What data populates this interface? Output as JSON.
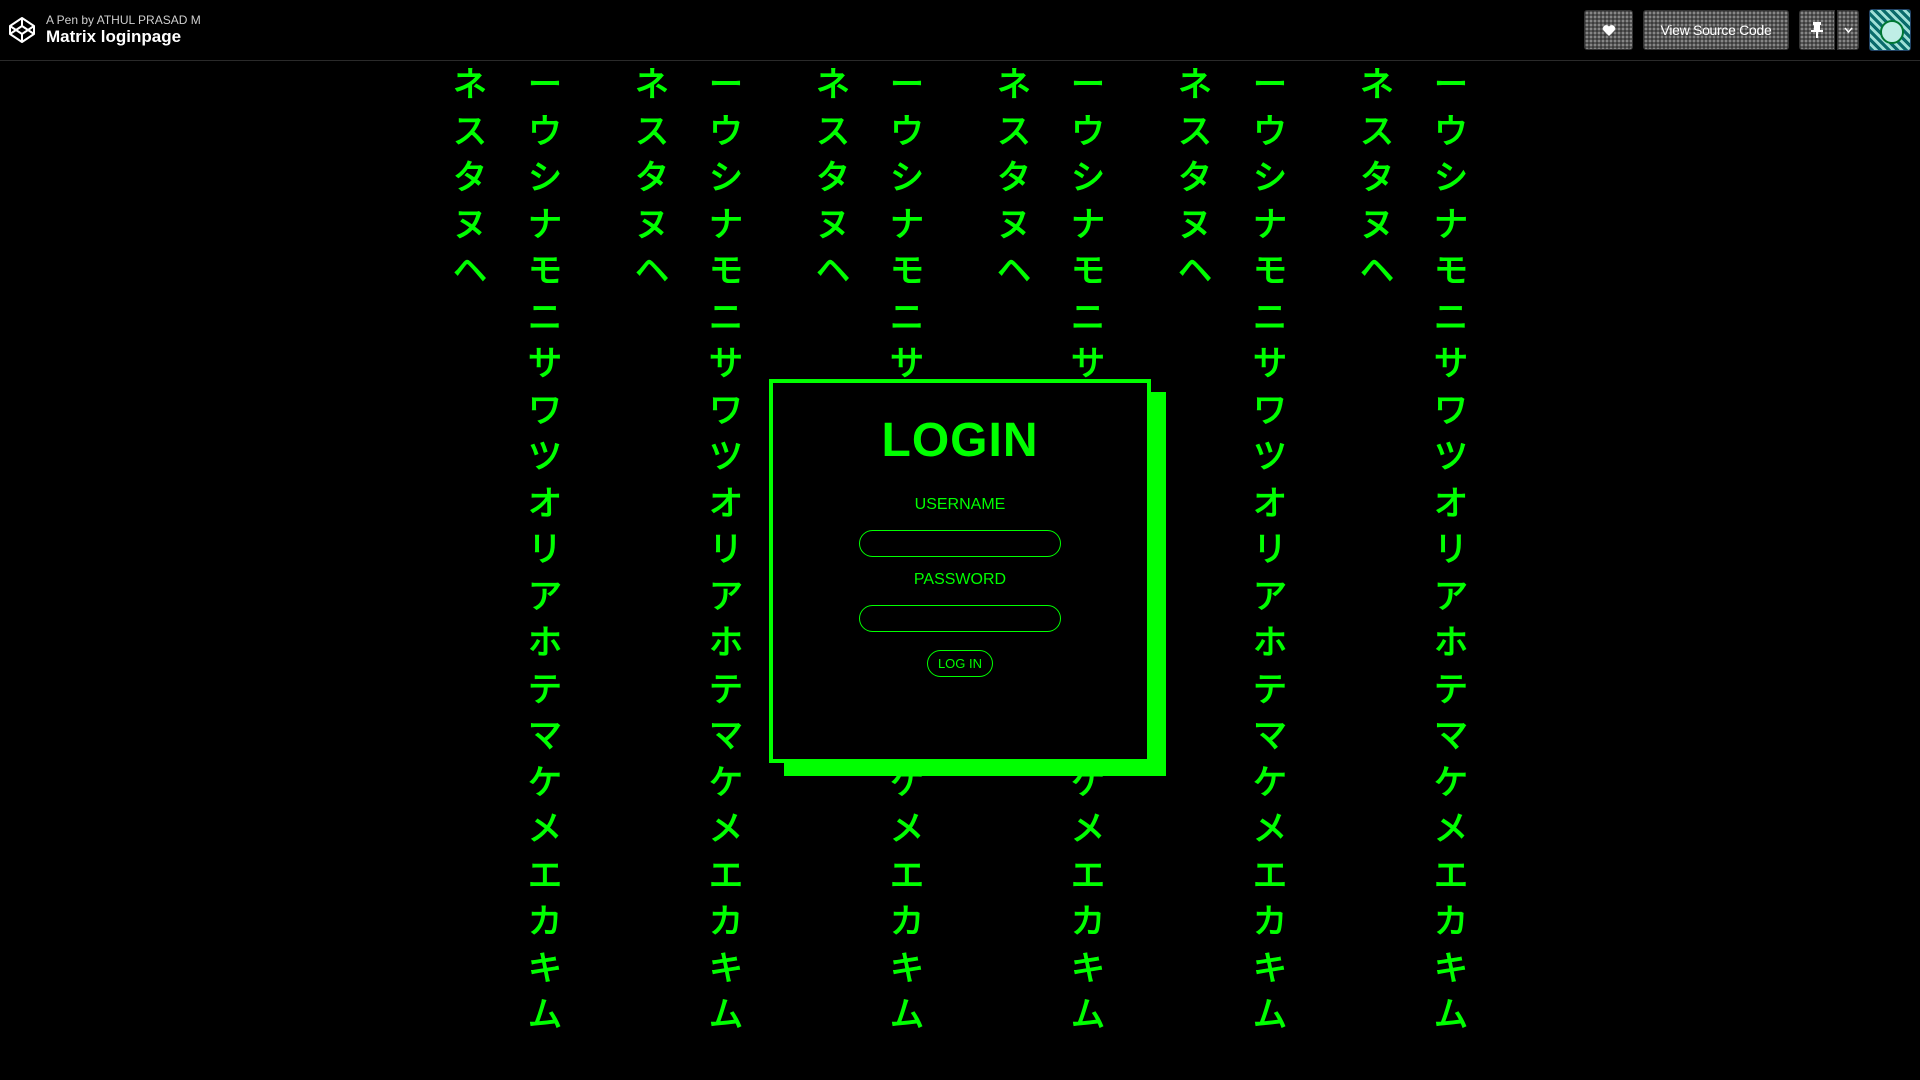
{
  "header": {
    "pen_by": "A Pen by ATHUL PRASAD M",
    "title": "Matrix loginpage",
    "view_source_label": "View Source Code",
    "heart_icon": "heart-icon",
    "pin_icon": "pin-icon",
    "caret_icon": "chevron-down-icon"
  },
  "rain": {
    "color": "#00ff00",
    "short_column": [
      "ネ",
      "ス",
      "タ",
      "ヌ",
      "ヘ"
    ],
    "long_column": [
      "ー",
      "ウ",
      "シ",
      "ナ",
      "モ",
      "ニ",
      "サ",
      "ワ",
      "ツ",
      "オ",
      "リ",
      "ア",
      "ホ",
      "テ",
      "マ",
      "ケ",
      "メ",
      "エ",
      "カ",
      "キ",
      "ム"
    ]
  },
  "login": {
    "title": "LOGIN",
    "username_label": "USERNAME",
    "username_value": "",
    "password_label": "PASSWORD",
    "password_value": "",
    "button_label": "LOG IN"
  }
}
